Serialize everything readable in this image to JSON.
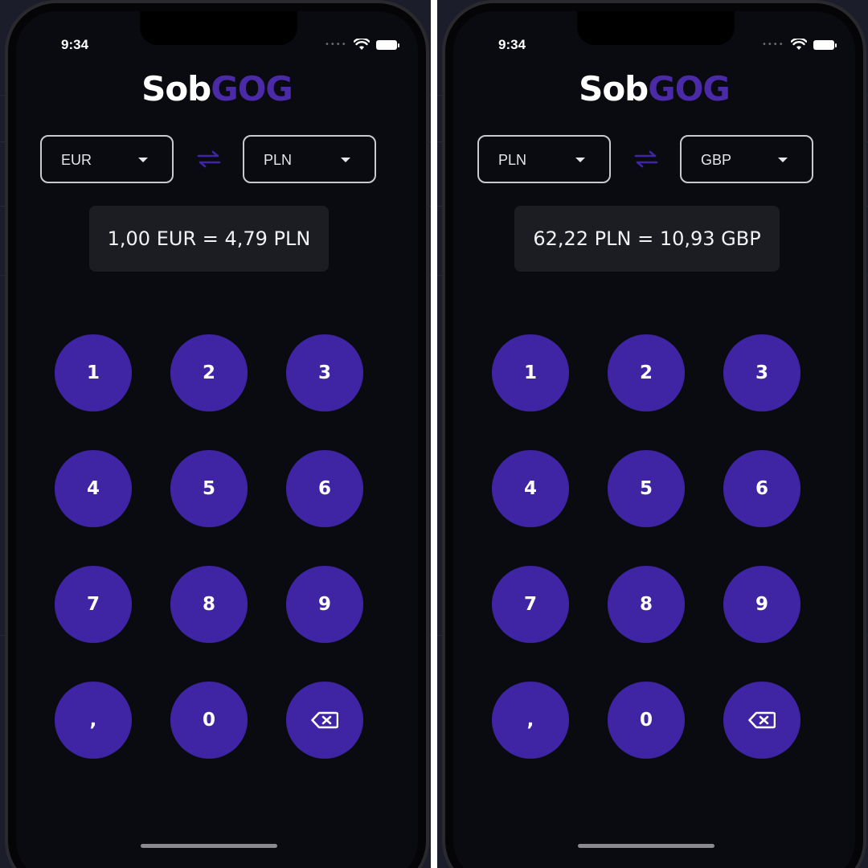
{
  "colors": {
    "accent": "#3f24a3",
    "logo_accent": "#4b2aa8",
    "screen_bg": "#0a0b10",
    "rate_bg": "#1c1d22"
  },
  "screens": [
    {
      "status_time": "9:34",
      "logo": {
        "part1": "Sob",
        "part2": "GOG"
      },
      "from_currency": "EUR",
      "to_currency": "PLN",
      "swap_icon": "swap-arrows-icon",
      "rate_text": "1,00 EUR = 4,79 PLN",
      "keypad": [
        "1",
        "2",
        "3",
        "4",
        "5",
        "6",
        "7",
        "8",
        "9",
        ",",
        "0"
      ],
      "backspace_icon": "backspace-icon"
    },
    {
      "status_time": "9:34",
      "logo": {
        "part1": "Sob",
        "part2": "GOG"
      },
      "from_currency": "PLN",
      "to_currency": "GBP",
      "swap_icon": "swap-arrows-icon",
      "rate_text": "62,22 PLN = 10,93 GBP",
      "keypad": [
        "1",
        "2",
        "3",
        "4",
        "5",
        "6",
        "7",
        "8",
        "9",
        ",",
        "0"
      ],
      "backspace_icon": "backspace-icon"
    }
  ]
}
